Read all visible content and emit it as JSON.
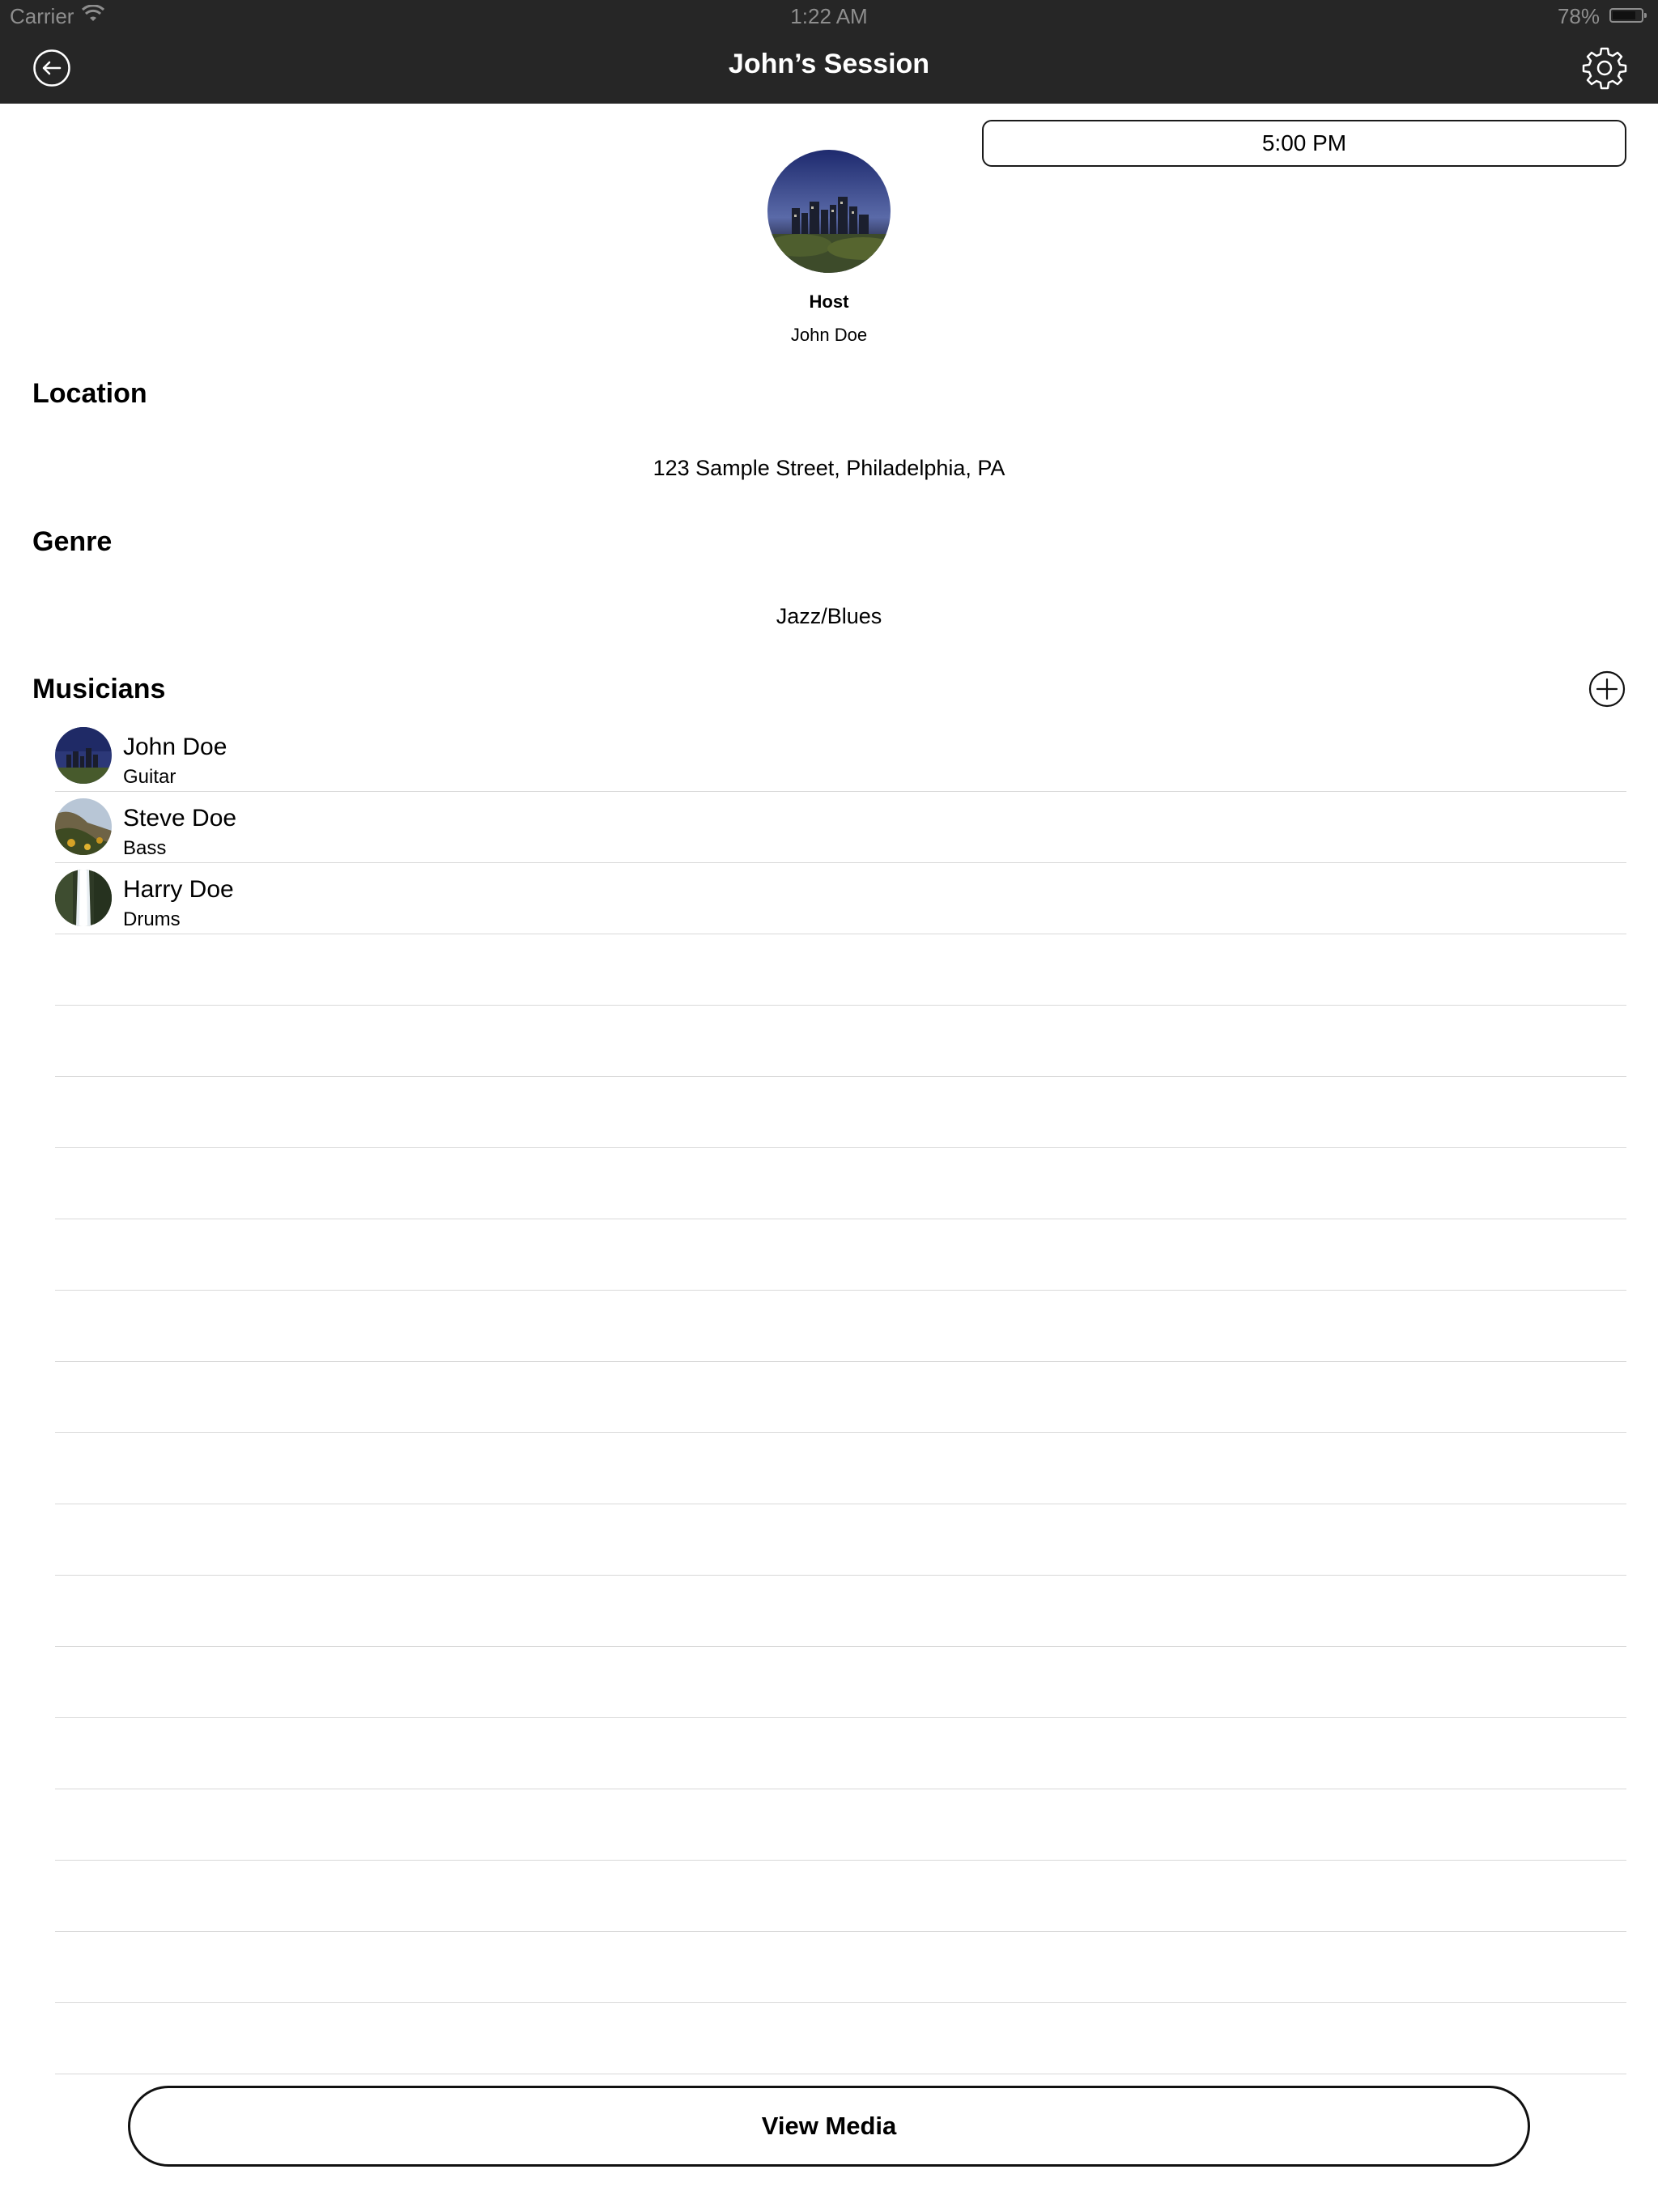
{
  "status_bar": {
    "carrier": "Carrier",
    "time": "1:22 AM",
    "battery_percent": "78%",
    "battery_level": 0.78
  },
  "nav": {
    "title": "John’s Session",
    "back_icon": "back-arrow-circle-icon",
    "settings_icon": "gear-icon"
  },
  "session": {
    "time": "5:00 PM"
  },
  "host": {
    "label": "Host",
    "name": "John Doe",
    "avatar": "city-skyline-photo"
  },
  "location": {
    "title": "Location",
    "value": "123 Sample Street, Philadelphia, PA"
  },
  "genre": {
    "title": "Genre",
    "value": "Jazz/Blues"
  },
  "musicians": {
    "title": "Musicians",
    "add_icon": "plus-circle-icon",
    "items": [
      {
        "name": "John Doe",
        "instrument": "Guitar",
        "avatar": "city-skyline-photo"
      },
      {
        "name": "Steve Doe",
        "instrument": "Bass",
        "avatar": "cliff-flowers-photo"
      },
      {
        "name": "Harry Doe",
        "instrument": "Drums",
        "avatar": "waterfall-photo"
      }
    ]
  },
  "footer": {
    "view_media_label": "View Media"
  }
}
